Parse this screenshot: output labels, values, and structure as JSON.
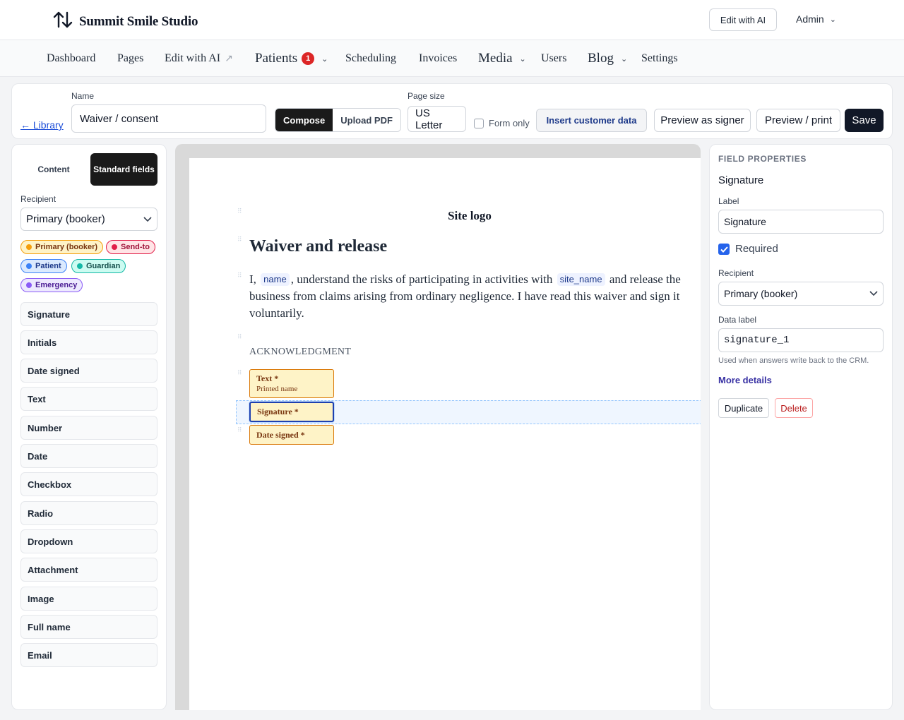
{
  "topbar": {
    "brand": "Summit Smile Studio",
    "edit_ai": "Edit with AI",
    "admin": "Admin"
  },
  "nav": {
    "items": [
      {
        "label": "Dashboard"
      },
      {
        "label": "Pages"
      },
      {
        "label": "Edit with AI"
      },
      {
        "label": "Patients",
        "badge": "1"
      },
      {
        "label": "Scheduling"
      },
      {
        "label": "Invoices"
      },
      {
        "label": "Media"
      },
      {
        "label": "Users"
      },
      {
        "label": "Blog"
      },
      {
        "label": "Settings"
      }
    ]
  },
  "toolbar": {
    "library_link": "← Library",
    "name_label": "Name",
    "name_value": "Waiver / consent",
    "mode_compose": "Compose",
    "mode_upload": "Upload PDF",
    "page_size_label": "Page size",
    "page_size_value": "US Letter",
    "form_only": "Form only",
    "insert_customer_data": "Insert customer data",
    "preview_signer": "Preview as signer",
    "preview_print": "Preview / print",
    "save": "Save"
  },
  "left_panel": {
    "tab_content": "Content",
    "tab_standard": "Standard fields",
    "recipient_label": "Recipient",
    "recipient_value": "Primary (booker)",
    "chips": [
      {
        "label": "Primary (booker)",
        "color": "#f59e0b"
      },
      {
        "label": "Send-to",
        "color": "#e11d48"
      },
      {
        "label": "Patient",
        "color": "#3b82f6"
      },
      {
        "label": "Guardian",
        "color": "#14b8a6"
      },
      {
        "label": "Emergency",
        "color": "#8b5cf6"
      }
    ],
    "fields": [
      "Signature",
      "Initials",
      "Date signed",
      "Text",
      "Number",
      "Date",
      "Checkbox",
      "Radio",
      "Dropdown",
      "Attachment",
      "Image",
      "Full name",
      "Email"
    ]
  },
  "document": {
    "site_logo": "Site logo",
    "title": "Waiver and release",
    "para_start": "I,",
    "token_name": "name",
    "para_mid": ", understand the risks of participating in activities with",
    "token_site": "site_name",
    "para_end": "and release the business from claims arising from ordinary negligence. I have read this waiver and sign it voluntarily.",
    "ack_heading": "ACKNOWLEDGMENT",
    "field_text": "Text *",
    "field_text_sub": "Printed name",
    "field_signature": "Signature *",
    "field_date": "Date signed *"
  },
  "properties": {
    "heading": "FIELD PROPERTIES",
    "type": "Signature",
    "label_label": "Label",
    "label_value": "Signature",
    "required": "Required",
    "recipient_label": "Recipient",
    "recipient_value": "Primary (booker)",
    "data_label_label": "Data label",
    "data_label_value": "signature_1",
    "help": "Used when answers write back to the CRM.",
    "more_details": "More details",
    "duplicate": "Duplicate",
    "delete": "Delete"
  }
}
